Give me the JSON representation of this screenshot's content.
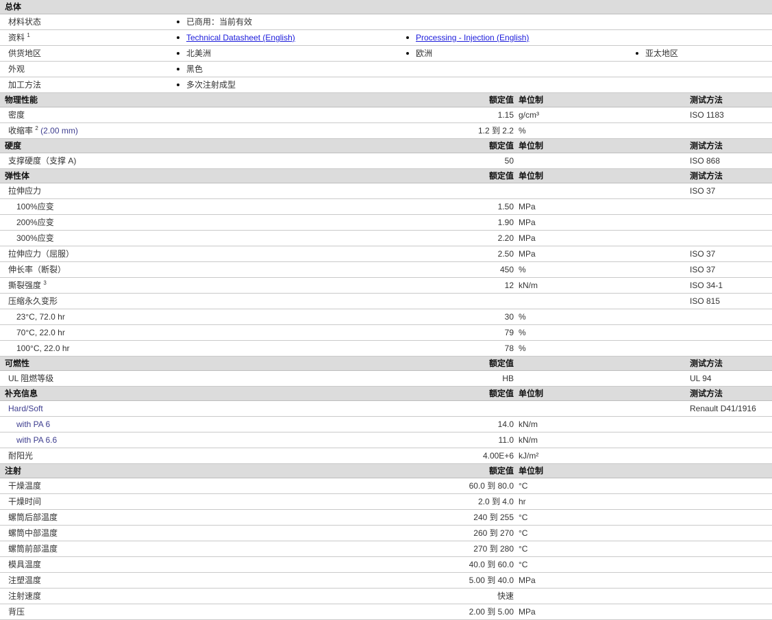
{
  "general": {
    "header": "总体",
    "material_status": {
      "label": "材料状态",
      "value": "已商用：当前有效"
    },
    "literature": {
      "label": "资料",
      "footnote": "1",
      "link1": "Technical Datasheet (English)",
      "link2": "Processing - Injection (English)"
    },
    "availability": {
      "label": "供货地区",
      "v1": "北美洲",
      "v2": "欧洲",
      "v3": "亚太地区"
    },
    "appearance": {
      "label": "外观",
      "value": "黑色"
    },
    "processing": {
      "label": "加工方法",
      "value": "多次注射成型"
    }
  },
  "columns": {
    "nominal": "额定值",
    "unit": "单位制",
    "method": "测试方法"
  },
  "physical": {
    "header": "物理性能",
    "rows": [
      {
        "label": "密度",
        "value": "1.15",
        "unit": "g/cm³",
        "method": "ISO 1183"
      },
      {
        "label": "收缩率",
        "footnote": "2",
        "cond": "(2.00 mm)",
        "value": "1.2 到  2.2",
        "unit": "%",
        "method": ""
      }
    ]
  },
  "hardness": {
    "header": "硬度",
    "rows": [
      {
        "label": "支撑硬度（支撑 A)",
        "value": "50",
        "unit": "",
        "method": "ISO 868"
      }
    ]
  },
  "elastomers": {
    "header": "弹性体",
    "rows": [
      {
        "label": "拉伸应力",
        "value": "",
        "unit": "",
        "method": "ISO 37"
      },
      {
        "label": "100%应变",
        "value": "1.50",
        "unit": "MPa",
        "method": ""
      },
      {
        "label": "200%应变",
        "value": "1.90",
        "unit": "MPa",
        "method": ""
      },
      {
        "label": "300%应变",
        "value": "2.20",
        "unit": "MPa",
        "method": ""
      },
      {
        "label": "拉伸应力（屈服）",
        "value": "2.50",
        "unit": "MPa",
        "method": "ISO 37"
      },
      {
        "label": "伸长率（断裂）",
        "value": "450",
        "unit": "%",
        "method": "ISO 37"
      },
      {
        "label": "撕裂强度",
        "footnote": "3",
        "value": "12",
        "unit": "kN/m",
        "method": "ISO 34-1"
      },
      {
        "label": "压缩永久变形",
        "value": "",
        "unit": "",
        "method": "ISO 815"
      },
      {
        "label": "23°C, 72.0 hr",
        "value": "30",
        "unit": "%",
        "method": ""
      },
      {
        "label": "70°C, 22.0 hr",
        "value": "79",
        "unit": "%",
        "method": ""
      },
      {
        "label": "100°C, 22.0 hr",
        "value": "78",
        "unit": "%",
        "method": ""
      }
    ]
  },
  "flammability": {
    "header": "可燃性",
    "rows": [
      {
        "label": "UL 阻燃等级",
        "value": "HB",
        "unit": "",
        "method": "UL 94"
      }
    ]
  },
  "additional": {
    "header": "补充信息",
    "rows": [
      {
        "label": "Hard/Soft",
        "value": "",
        "unit": "",
        "method": "Renault D41/1916"
      },
      {
        "label": "with PA 6",
        "value": "14.0",
        "unit": "kN/m",
        "method": ""
      },
      {
        "label": "with PA 6.6",
        "value": "11.0",
        "unit": "kN/m",
        "method": ""
      },
      {
        "label": "耐阳光",
        "value": "4.00E+6",
        "unit": "kJ/m²",
        "method": ""
      }
    ]
  },
  "injection": {
    "header": "注射",
    "rows": [
      {
        "label": "干燥温度",
        "value": "60.0 到  80.0",
        "unit": "°C"
      },
      {
        "label": "干燥时间",
        "value": "2.0 到  4.0",
        "unit": "hr"
      },
      {
        "label": "螺筒后部温度",
        "value": "240 到  255",
        "unit": "°C"
      },
      {
        "label": "螺筒中部温度",
        "value": "260 到  270",
        "unit": "°C"
      },
      {
        "label": "螺筒前部温度",
        "value": "270 到  280",
        "unit": "°C"
      },
      {
        "label": "模具温度",
        "value": "40.0 到  60.0",
        "unit": "°C"
      },
      {
        "label": "注塑温度",
        "value": "5.00 到  40.0",
        "unit": "MPa"
      },
      {
        "label": "注射速度",
        "value": "快速",
        "unit": ""
      },
      {
        "label": "背压",
        "value": "2.00 到  5.00",
        "unit": "MPa"
      }
    ]
  }
}
